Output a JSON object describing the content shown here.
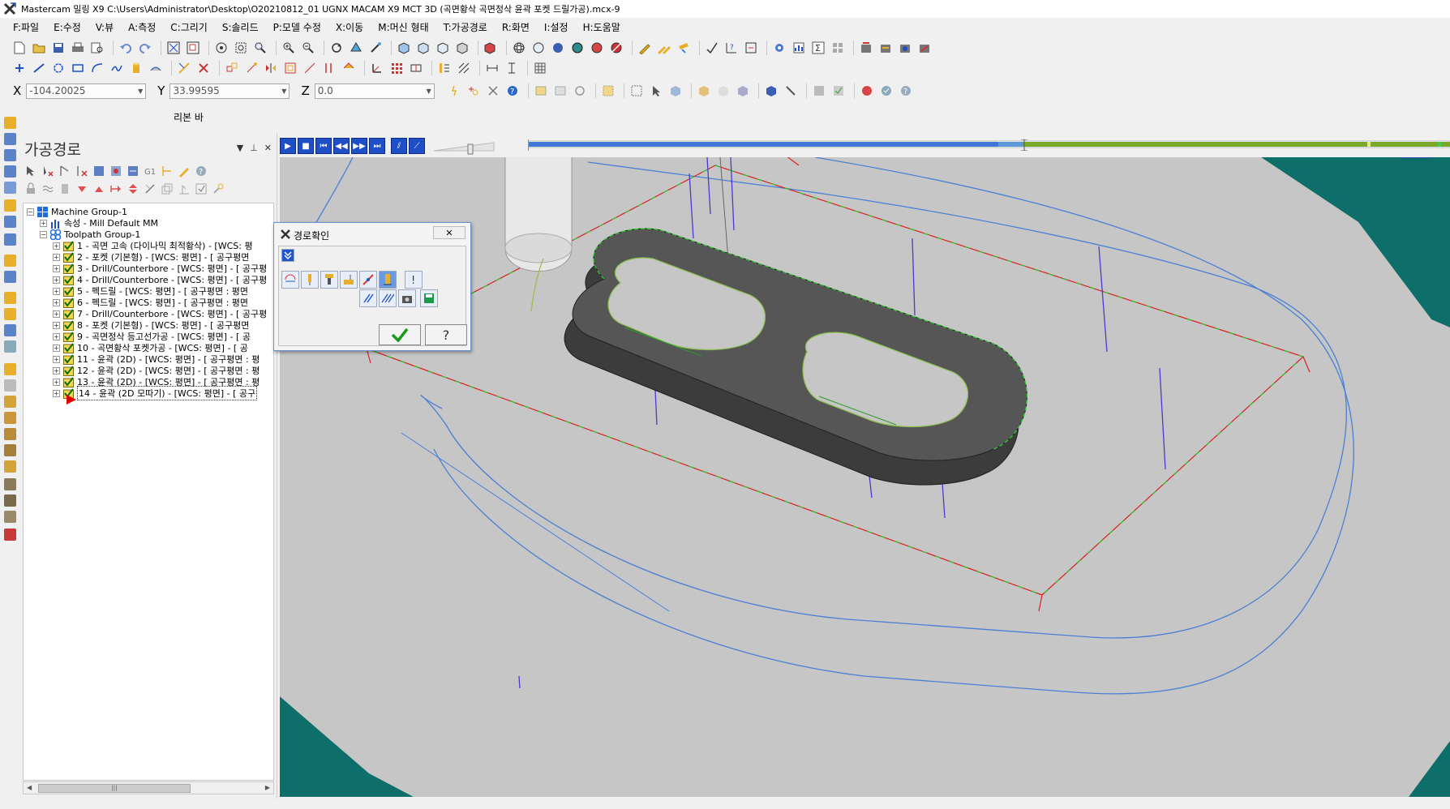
{
  "window": {
    "title": "Mastercam 밀링 X9  C:\\Users\\Administrator\\Desktop\\O20210812_01 UGNX MACAM X9 MCT 3D (곡면황삭 곡면정삭 윤곽 포켓 드릴가공).mcx-9"
  },
  "menu": [
    "F:파일",
    "E:수정",
    "V:뷰",
    "A:측정",
    "C:그리기",
    "S:솔리드",
    "P:모델 수정",
    "X:이동",
    "M:머신 형태",
    "T:가공경로",
    "R:화면",
    "I:설정",
    "H:도움말"
  ],
  "coords": {
    "x_label": "X",
    "x_value": "-104.20025",
    "y_label": "Y",
    "y_value": "33.99595",
    "z_label": "Z",
    "z_value": "0.0"
  },
  "ribbon": {
    "label": "리본 바"
  },
  "panel": {
    "title": "가공경로",
    "machine_group": "Machine Group-1",
    "properties": "속성 - Mill Default MM",
    "toolpath_group": "Toolpath Group-1",
    "operations": [
      "1 - 곡면 고속 (다이나믹 최적황삭) - [WCS: 평",
      "2 - 포켓 (기본형) - [WCS: 평면] - [  공구평면",
      "3 - Drill/Counterbore - [WCS: 평면] - [  공구평",
      "4 - Drill/Counterbore - [WCS: 평면] - [  공구평",
      "5 - 펙드릴 - [WCS: 평면] - [  공구평면  : 평면",
      "6 - 펙드릴 - [WCS: 평면] - [  공구평면  : 평면",
      "7 - Drill/Counterbore - [WCS: 평면] - [  공구평",
      "8 - 포켓 (기본형) - [WCS: 평면] - [  공구평면",
      "9 - 곡면정삭 등고선가공 - [WCS: 평면] - [  공",
      "10 - 곡면황삭 포켓가공 - [WCS: 평면] - [  공",
      "11 - 윤곽 (2D) - [WCS: 평면] - [  공구평면  : 평",
      "12 - 윤곽 (2D) - [WCS: 평면] - [  공구평면  : 평",
      "13 - 윤곽 (2D) - [WCS: 평면] - [  공구평면  : 평",
      "14 - 윤곽 (2D 모따기) - [WCS: 평면] - [  공구"
    ],
    "selected_index": 13
  },
  "dialog": {
    "title": "경로확인",
    "close_label": "✕",
    "help_label": "?"
  },
  "colors": {
    "viewport_bg": "#c4c4c4",
    "stock_teal": "#0e6e6a",
    "sim_blue": "#3f78d4",
    "sim_green": "#7aa82a"
  }
}
